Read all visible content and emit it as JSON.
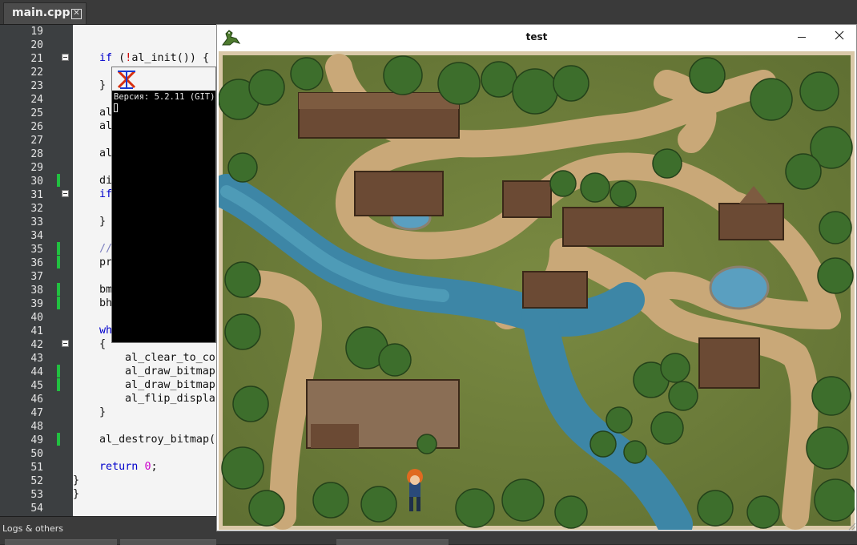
{
  "tabs": [
    {
      "label": "main.cpp",
      "close": "✕"
    }
  ],
  "gutter": {
    "line_numbers": [
      "19",
      "20",
      "21",
      "22",
      "23",
      "24",
      "25",
      "26",
      "27",
      "28",
      "29",
      "30",
      "31",
      "32",
      "33",
      "34",
      "35",
      "36",
      "37",
      "38",
      "39",
      "40",
      "41",
      "42",
      "43",
      "44",
      "45",
      "46",
      "47",
      "48",
      "49",
      "50",
      "51",
      "52",
      "53",
      "54"
    ]
  },
  "code": {
    "l21": {
      "a": "if",
      "b": " (",
      "c": "!",
      "d": "al_init()) {"
    },
    "l23": "}",
    "l25": "al",
    "l26": "al",
    "l28": "al",
    "l30": "di",
    "l31": "if",
    "l33": "}",
    "l35": "//",
    "l36": "pr",
    "l38": "bm",
    "l39": "bh",
    "l41": "wh",
    "l42": "{",
    "l43": "al_clear_to_co",
    "l44": "al_draw_bitmap",
    "l45": "al_draw_bitmap",
    "l46": "al_flip_displa",
    "l47": "}",
    "l49": "al_destroy_bitmap(",
    "l51a": "return",
    "l51b": "0",
    "l51c": ";",
    "l52": "}",
    "l53": "}"
  },
  "console": {
    "icon": "allegro-x-icon",
    "version_text": "Версия: 5.2.11 (GIT)"
  },
  "game_window": {
    "title": "test",
    "icon": "crocodile-icon",
    "minimize": "minimize-icon",
    "close": "close-icon"
  },
  "bottom_panel": {
    "label": "Logs & others"
  },
  "colors": {
    "change_marker": "#21c040",
    "keyword": "#0000cc",
    "number": "#cc00cc",
    "comment": "#7b7ebf"
  }
}
